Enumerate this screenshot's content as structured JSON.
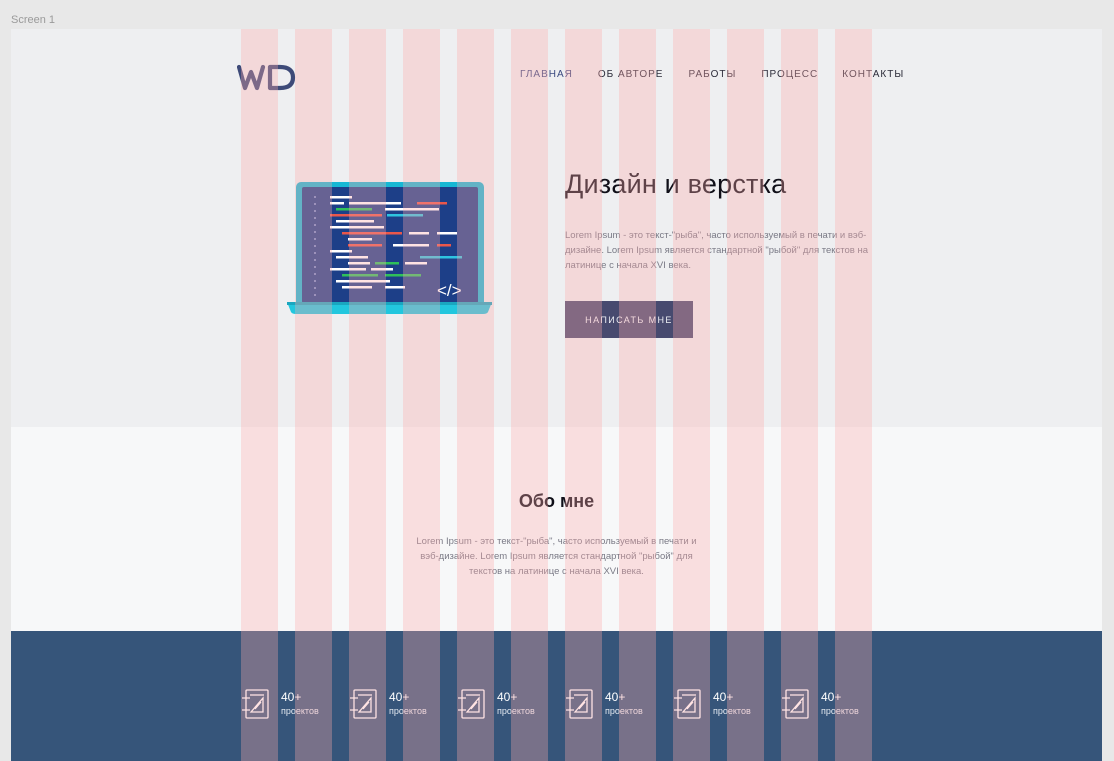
{
  "screen_label": "Screen 1",
  "logo": "WD",
  "nav": [
    {
      "label": "ГЛАВНАЯ",
      "active": true
    },
    {
      "label": "ОБ АВТОРЕ",
      "active": false
    },
    {
      "label": "РАБОТЫ",
      "active": false
    },
    {
      "label": "ПРОЦЕСС",
      "active": false
    },
    {
      "label": "КОНТАКТЫ",
      "active": false
    }
  ],
  "hero": {
    "title": "Дизайн и верстка",
    "text": "Lorem Ipsum - это текст-\"рыба\", часто используемый в печати и вэб-дизайне. Lorem Ipsum является стандартной \"рыбой\" для текстов на латинице с начала XVI века.",
    "button": "НАПИСАТЬ МНЕ",
    "code_tag": "</>"
  },
  "about": {
    "title": "Обо мне",
    "text": "Lorem Ipsum - это текст-\"рыба\", часто используемый в печати и вэб-дизайне. Lorem Ipsum является стандартной \"рыбой\" для текстов на латинице с начала XVI века."
  },
  "stats": [
    {
      "value": "40+",
      "label": "проектов",
      "icon": "project-drawing-icon"
    },
    {
      "value": "40+",
      "label": "проектов",
      "icon": "project-drawing-icon"
    },
    {
      "value": "40+",
      "label": "проектов",
      "icon": "project-drawing-icon"
    },
    {
      "value": "40+",
      "label": "проектов",
      "icon": "project-drawing-icon"
    },
    {
      "value": "40+",
      "label": "проектов",
      "icon": "project-drawing-icon"
    },
    {
      "value": "40+",
      "label": "проектов",
      "icon": "project-drawing-icon"
    }
  ],
  "colors": {
    "hero_bg": "#eeeff1",
    "about_bg": "#f7f8f9",
    "stats_bg": "#36557a",
    "button_bg": "#474a6f",
    "logo": "#3d4a78",
    "grid_overlay": "#ffaaaa"
  }
}
